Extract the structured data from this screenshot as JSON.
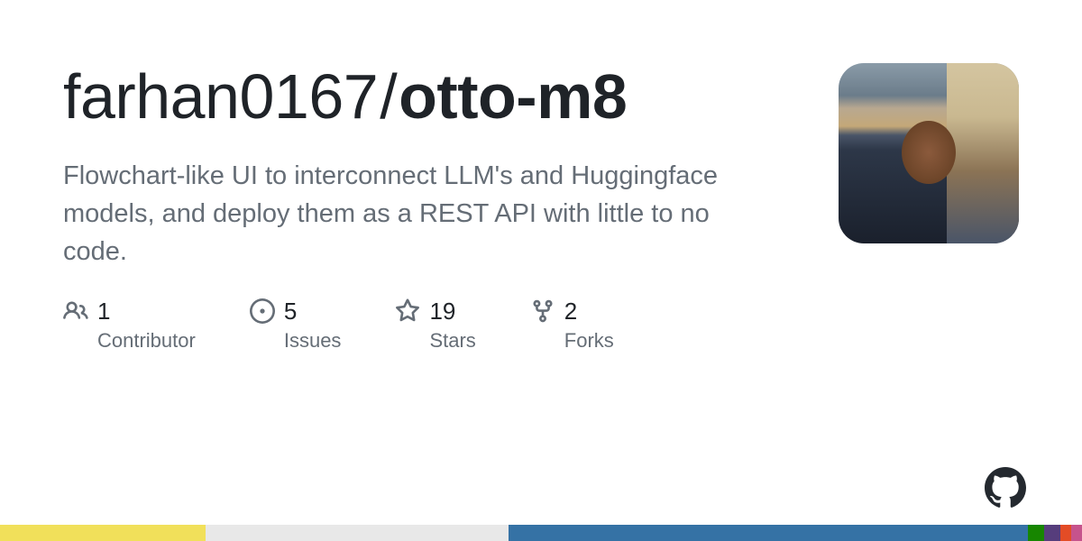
{
  "repo": {
    "owner": "farhan0167",
    "name": "otto-m8",
    "description": "Flowchart-like UI to interconnect LLM's and Huggingface models, and deploy them as a REST API with little to no code."
  },
  "stats": {
    "contributors": {
      "value": "1",
      "label": "Contributor"
    },
    "issues": {
      "value": "5",
      "label": "Issues"
    },
    "stars": {
      "value": "19",
      "label": "Stars"
    },
    "forks": {
      "value": "2",
      "label": "Forks"
    }
  },
  "languages": [
    {
      "color": "#f1e05a",
      "percent": 19
    },
    {
      "color": "#e8e8e8",
      "percent": 28
    },
    {
      "color": "#3572A5",
      "percent": 48
    },
    {
      "color": "#178600",
      "percent": 1.5
    },
    {
      "color": "#563d7c",
      "percent": 1.5
    },
    {
      "color": "#e34c26",
      "percent": 1
    },
    {
      "color": "#c6538c",
      "percent": 1
    }
  ]
}
